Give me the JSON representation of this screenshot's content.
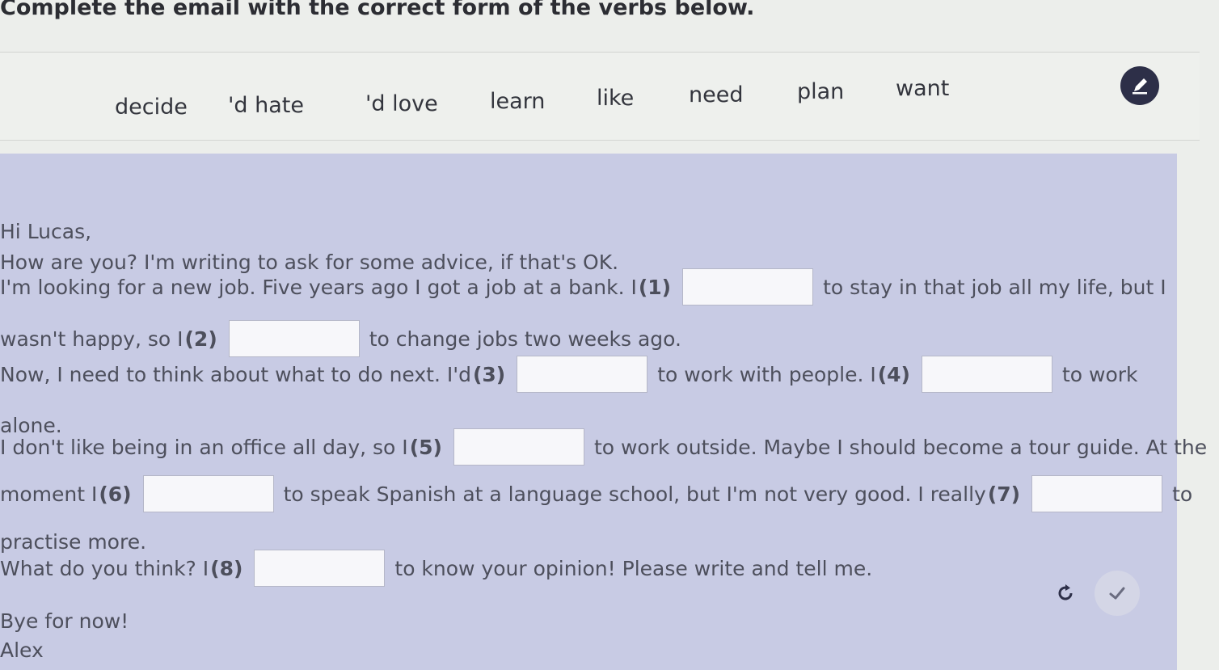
{
  "instruction": "Complete the email with the correct form of the verbs below.",
  "word_bank": [
    "decide",
    "'d hate",
    "'d love",
    "learn",
    "like",
    "need",
    "plan",
    "want"
  ],
  "email": {
    "greeting": "Hi Lucas,",
    "line1": "How are you? I'm writing to ask for some advice, if that's OK.",
    "l2a": "I'm looking for a new job. Five years ago I got a job at a bank. I",
    "n1": "(1)",
    "l2b": "to stay in that job all my life, but I",
    "l3a": "wasn't happy, so I",
    "n2": "(2)",
    "l3b": "to change jobs two weeks ago.",
    "l4a": "Now, I need to think about what to do next. I'd",
    "n3": "(3)",
    "l4b": "to work with people. I",
    "n4": "(4)",
    "l4c": "to work",
    "l5": "alone.",
    "l6a": "I don't like being in an office all day, so I",
    "n5": "(5)",
    "l6b": "to work outside. Maybe I should become a tour guide. At the",
    "l7a": "moment I",
    "n6": "(6)",
    "l7b": "to speak Spanish at a language school, but I'm not very good. I really",
    "n7": "(7)",
    "l7c": "to",
    "l8": "practise more.",
    "l9a": "What do you think? I",
    "n8": "(8)",
    "l9b": "to know your opinion! Please write and tell me.",
    "l10": "Bye for now!",
    "signature": "Alex"
  },
  "icons": {
    "edit": "pencil-icon",
    "reset": "reset-icon",
    "check": "check-icon"
  },
  "colors": {
    "email_bg": "#c8cbe4",
    "edit_button": "#2d2f48",
    "answer_box": "#f7f7fa"
  }
}
